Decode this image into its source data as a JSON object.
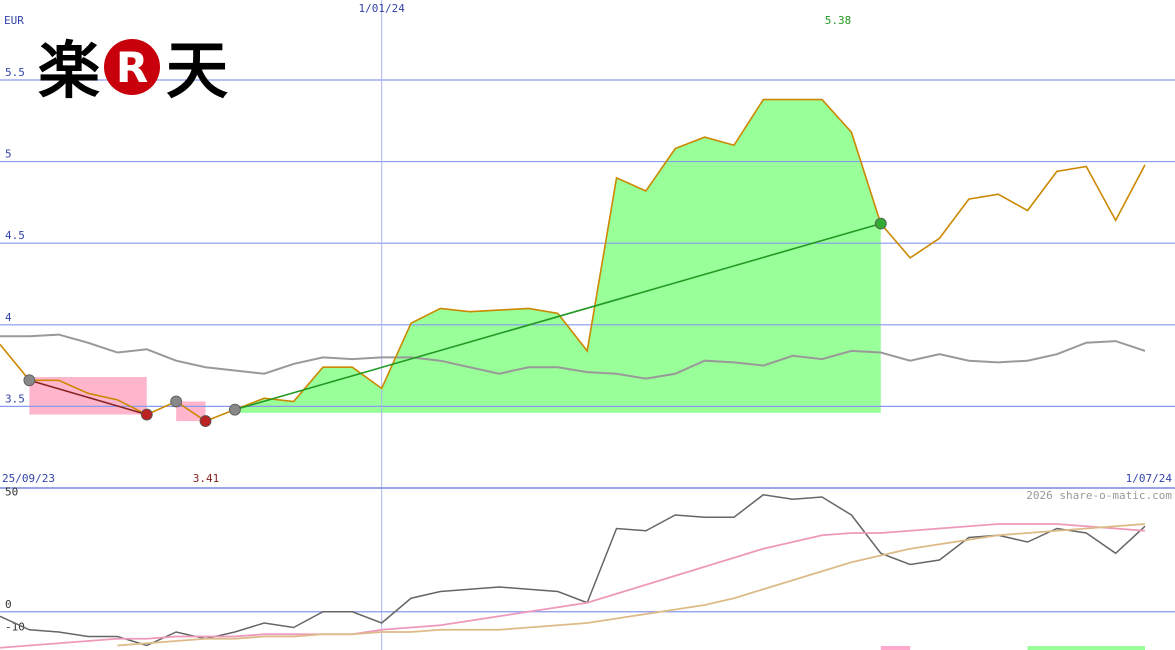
{
  "chart_data": [
    {
      "type": "line",
      "currency_label": "EUR",
      "y_ticks": [
        3.5,
        4,
        4.5,
        5,
        5.5
      ],
      "y_tick_labels": [
        "3.5",
        "4",
        "4.5",
        "5",
        "5.5"
      ],
      "ylim": [
        3.0,
        5.99
      ],
      "x_labels": [
        {
          "label": "25/09/23",
          "index": 0
        },
        {
          "label": "1/01/24",
          "index": 13
        },
        {
          "label": "1/07/24",
          "index": 39
        }
      ],
      "high_label": "5.38",
      "low_label": "3.41",
      "series": [
        {
          "values": [
            3.88,
            3.66,
            3.66,
            3.58,
            3.54,
            3.45,
            3.53,
            3.41,
            3.48,
            3.55,
            3.53,
            3.74,
            3.74,
            3.61,
            4.01,
            4.1,
            4.08,
            4.09,
            4.1,
            4.07,
            3.84,
            4.9,
            4.82,
            5.08,
            5.15,
            5.1,
            5.38,
            5.38,
            5.38,
            5.18,
            4.62,
            4.41,
            4.53,
            4.77,
            4.8,
            4.7,
            4.94,
            4.97,
            4.64,
            4.98
          ],
          "color": "#cc8800"
        },
        {
          "values": [
            3.93,
            3.93,
            3.94,
            3.89,
            3.83,
            3.85,
            3.78,
            3.74,
            3.72,
            3.7,
            3.76,
            3.8,
            3.79,
            3.8,
            3.8,
            3.78,
            3.74,
            3.7,
            3.74,
            3.74,
            3.71,
            3.7,
            3.67,
            3.7,
            3.78,
            3.77,
            3.75,
            3.81,
            3.79,
            3.84,
            3.83,
            3.78,
            3.82,
            3.78,
            3.77,
            3.78,
            3.82,
            3.89,
            3.9,
            3.84
          ],
          "color": "#999999"
        }
      ],
      "green_zone": {
        "start": 8,
        "end": 30,
        "baseline": 3.46
      },
      "pink_zones": [
        {
          "start": 1,
          "end": 5,
          "top": 3.68
        },
        {
          "start": 6,
          "end": 7,
          "top": 3.53
        }
      ],
      "trades": [
        {
          "from": 1,
          "to": 5,
          "color": "#882222"
        },
        {
          "from": 8,
          "to": 30,
          "color": "#229922"
        }
      ],
      "markers": [
        {
          "index": 1,
          "type": "grey"
        },
        {
          "index": 5,
          "type": "sell"
        },
        {
          "index": 6,
          "type": "grey"
        },
        {
          "index": 7,
          "type": "sell"
        },
        {
          "index": 8,
          "type": "grey"
        },
        {
          "index": 30,
          "type": "buy"
        }
      ]
    },
    {
      "type": "line",
      "y_tick_labels": [
        "50",
        "0",
        "-10"
      ],
      "y_ticks": [
        50,
        0,
        -10
      ],
      "ylim": [
        -17,
        55
      ],
      "credit": "2026 share-o-matic.com",
      "series": [
        {
          "values": [
            -2,
            -8,
            -9,
            -11,
            -11,
            -15,
            -9,
            -12,
            -9,
            -5,
            -7,
            0,
            0,
            -5,
            6,
            9,
            10,
            11,
            10,
            9,
            4,
            37,
            36,
            43,
            42,
            42,
            52,
            50,
            51,
            43,
            26,
            21,
            23,
            33,
            34,
            31,
            37,
            35,
            26,
            38
          ],
          "color": "#666666"
        },
        {
          "values": [
            -16,
            -15,
            -14,
            -13,
            -12,
            -12,
            -11,
            -11,
            -11,
            -10,
            -10,
            -10,
            -10,
            -8,
            -7,
            -6,
            -4,
            -2,
            0,
            2,
            4,
            8,
            12,
            16,
            20,
            24,
            28,
            31,
            34,
            35,
            35,
            36,
            37,
            38,
            39,
            39,
            39,
            38,
            37,
            36
          ],
          "color": "#ee99bb"
        },
        {
          "values": [
            null,
            null,
            null,
            null,
            -15,
            -14,
            -13,
            -12,
            -12,
            -11,
            -11,
            -10,
            -10,
            -9,
            -9,
            -8,
            -8,
            -8,
            -7,
            -6,
            -5,
            -3,
            -1,
            1,
            3,
            6,
            10,
            14,
            18,
            22,
            25,
            28,
            30,
            32,
            34,
            35,
            36,
            37,
            38,
            39
          ],
          "color": "#ddbb88"
        }
      ],
      "bottom_bars": [
        {
          "start": 30,
          "end": 31,
          "color": "#ffaacc"
        },
        {
          "start": 35,
          "end": 39,
          "color": "#99ff99"
        }
      ]
    }
  ],
  "logo": {
    "left_glyph": "楽",
    "circle_glyph": "R",
    "right_glyph": "天"
  }
}
